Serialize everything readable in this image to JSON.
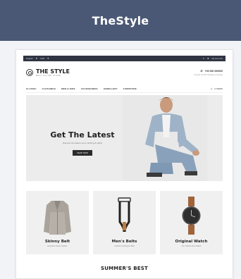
{
  "banner": {
    "title": "TheStyle",
    "color": "#4b5875"
  },
  "topbar": {
    "language": "English",
    "currency": "USD",
    "account": "My Account"
  },
  "header": {
    "logo_name": "THE STYLE",
    "logo_tagline": "BEST ONLINE STORE",
    "phone": "+00 000 000000",
    "contact_sub": "Contact Us 24/7 Monday to Sunday"
  },
  "nav": {
    "items": [
      "CLASSIC",
      "CLOTHINGS",
      "MEN & KIDS",
      "ACCESSORIES",
      "JEWELLERY",
      "FURNITURE"
    ],
    "cart_label": "0 ITEMS"
  },
  "hero": {
    "title": "Get The Latest",
    "subtitle": "Discover the latest men's clothing & watch",
    "button": "SHOP NOW"
  },
  "products": [
    {
      "title": "Skinny Belt",
      "subtitle": "Exclusive Super Leather"
    },
    {
      "title": "Men's Belts",
      "subtitle": "Fashion & Designer Belt"
    },
    {
      "title": "Original Watch",
      "subtitle": "The Classic Pure Watch"
    }
  ],
  "section": {
    "title": "SUMMER'S BEST"
  }
}
